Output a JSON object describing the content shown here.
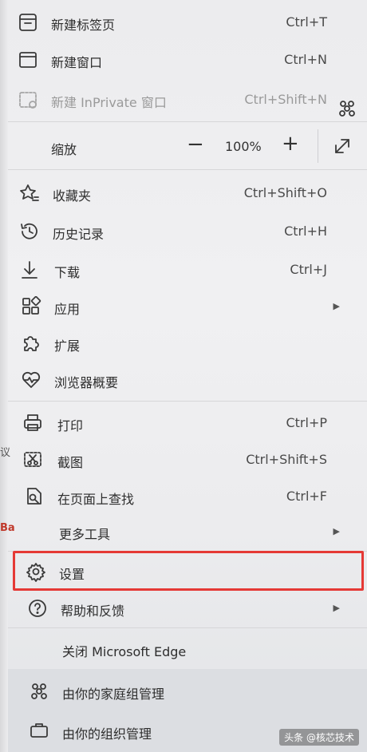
{
  "menu": {
    "new_tab": {
      "label": "新建标签页",
      "shortcut": "Ctrl+T"
    },
    "new_window": {
      "label": "新建窗口",
      "shortcut": "Ctrl+N"
    },
    "new_inprivate": {
      "label": "新建 InPrivate 窗口",
      "shortcut": "Ctrl+Shift+N"
    },
    "zoom": {
      "label": "缩放",
      "minus": "−",
      "value": "100%",
      "plus": "+"
    },
    "favorites": {
      "label": "收藏夹",
      "shortcut": "Ctrl+Shift+O"
    },
    "history": {
      "label": "历史记录",
      "shortcut": "Ctrl+H"
    },
    "downloads": {
      "label": "下载",
      "shortcut": "Ctrl+J"
    },
    "apps": {
      "label": "应用"
    },
    "extensions": {
      "label": "扩展"
    },
    "browser_essentials": {
      "label": "浏览器概要"
    },
    "print": {
      "label": "打印",
      "shortcut": "Ctrl+P"
    },
    "screenshot": {
      "label": "截图",
      "shortcut": "Ctrl+Shift+S"
    },
    "find_on_page": {
      "label": "在页面上查找",
      "shortcut": "Ctrl+F"
    },
    "more_tools": {
      "label": "更多工具"
    },
    "settings": {
      "label": "设置"
    },
    "help_feedback": {
      "label": "帮助和反馈"
    },
    "close_edge": {
      "label": "关闭 Microsoft Edge"
    },
    "family_managed": {
      "label": "由你的家庭组管理"
    },
    "org_managed": {
      "label": "由你的组织管理"
    }
  },
  "highlight_color": "#e53935",
  "watermark": "头条 @核芯技术",
  "background_fragments": {
    "a": "议",
    "b": "Ba"
  }
}
